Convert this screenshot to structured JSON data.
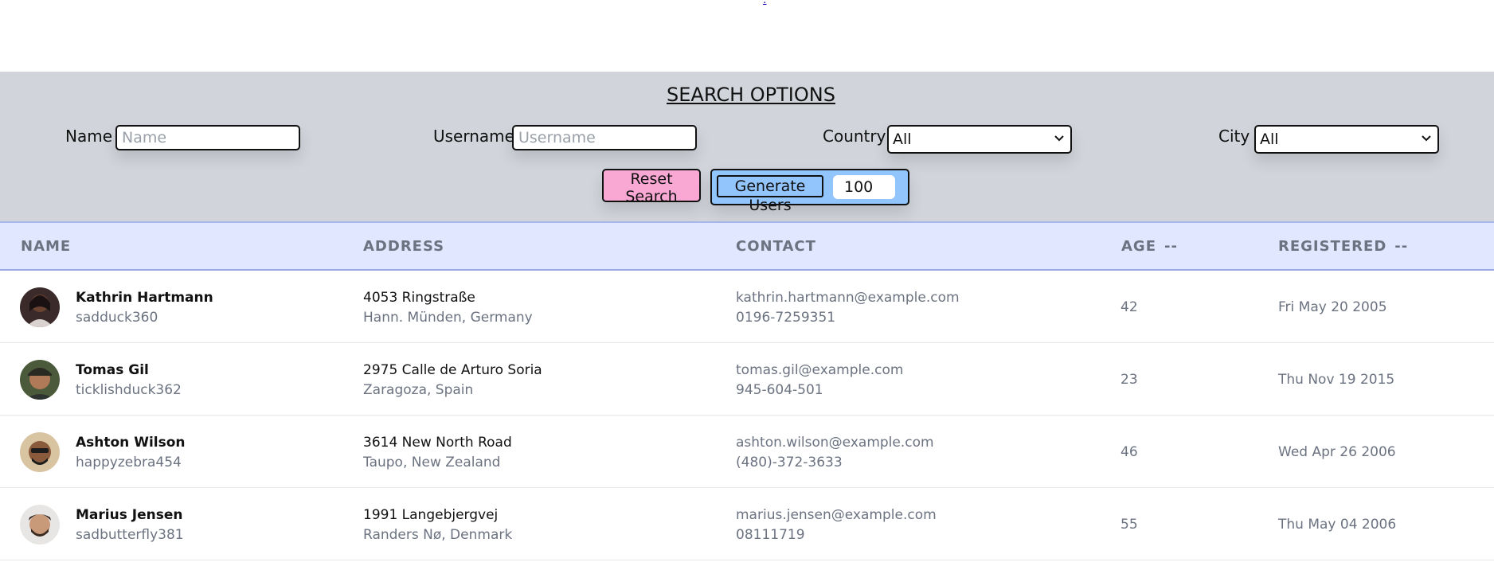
{
  "top_link": ".",
  "search": {
    "title": "SEARCH OPTIONS",
    "name_label": "Name",
    "name_placeholder": "Name",
    "name_value": "",
    "username_label": "Username",
    "username_placeholder": "Username",
    "username_value": "",
    "country_label": "Country",
    "country_value": "All",
    "city_label": "City",
    "city_value": "All",
    "reset_label": "Reset Search",
    "generate_label": "Generate Users",
    "generate_count": "100"
  },
  "table": {
    "columns": [
      {
        "label": "NAME",
        "sort": ""
      },
      {
        "label": "ADDRESS",
        "sort": ""
      },
      {
        "label": "CONTACT",
        "sort": ""
      },
      {
        "label": "AGE",
        "sort": "--"
      },
      {
        "label": "REGISTERED",
        "sort": "--"
      }
    ],
    "rows": [
      {
        "name": "Kathrin Hartmann",
        "username": "sadduck360",
        "street": "4053 Ringstraße",
        "city": "Hann. Münden, Germany",
        "email": "kathrin.hartmann@example.com",
        "phone": "0196-7259351",
        "age": "42",
        "registered": "Fri May 20 2005"
      },
      {
        "name": "Tomas Gil",
        "username": "ticklishduck362",
        "street": "2975 Calle de Arturo Soria",
        "city": "Zaragoza, Spain",
        "email": "tomas.gil@example.com",
        "phone": "945-604-501",
        "age": "23",
        "registered": "Thu Nov 19 2015"
      },
      {
        "name": "Ashton Wilson",
        "username": "happyzebra454",
        "street": "3614 New North Road",
        "city": "Taupo, New Zealand",
        "email": "ashton.wilson@example.com",
        "phone": "(480)-372-3633",
        "age": "46",
        "registered": "Wed Apr 26 2006"
      },
      {
        "name": "Marius Jensen",
        "username": "sadbutterfly381",
        "street": "1991 Langebjergvej",
        "city": "Randers Nø, Denmark",
        "email": "marius.jensen@example.com",
        "phone": "08111719",
        "age": "55",
        "registered": "Thu May 04 2006"
      }
    ]
  },
  "colors": {
    "panel_bg": "#d1d5db",
    "header_bg": "#e0e7ff",
    "reset_bg": "#f9a8d4",
    "generate_bg": "#93c5fd"
  }
}
